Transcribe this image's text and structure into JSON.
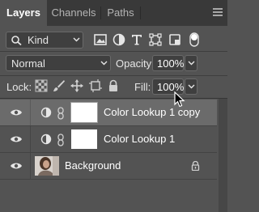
{
  "tabs": [
    {
      "label": "Layers",
      "active": true
    },
    {
      "label": "Channels",
      "active": false
    },
    {
      "label": "Paths",
      "active": false
    }
  ],
  "filter": {
    "kind_label": "Kind",
    "icons": [
      "pixel-filter-icon",
      "adjustment-filter-icon",
      "type-filter-icon",
      "shape-filter-icon",
      "smart-object-filter-icon",
      "filter-toggle-icon"
    ]
  },
  "blend": {
    "mode": "Normal",
    "opacity_label": "Opacity:",
    "opacity_value": "100%"
  },
  "lock": {
    "label": "Lock:",
    "icons": [
      "lock-transparent-pixels-icon",
      "lock-image-pixels-icon",
      "lock-position-icon",
      "lock-artboard-icon",
      "lock-all-icon"
    ],
    "fill_label": "Fill:",
    "fill_value": "100%"
  },
  "layers": [
    {
      "name": "Color Lookup 1 copy",
      "type": "adjustment",
      "selected": true,
      "visible": true
    },
    {
      "name": "Color Lookup 1",
      "type": "adjustment",
      "selected": false,
      "visible": true
    },
    {
      "name": "Background",
      "type": "pixel",
      "selected": false,
      "visible": true,
      "locked": true
    }
  ],
  "colors": {
    "panel_bg": "#535353",
    "tabbar_bg": "#393939",
    "selected_row": "#6b6b6b",
    "field_bg": "#3f3f3f"
  }
}
